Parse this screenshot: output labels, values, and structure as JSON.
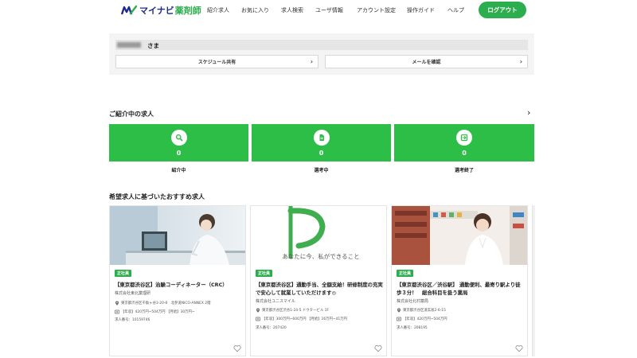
{
  "header": {
    "logo_text": "マイナビ",
    "logo_sub": "薬剤師",
    "nav": [
      "紹介求人",
      "お気に入り",
      "求人検索",
      "ユーザ情報",
      "アカウント設定",
      "操作ガイド",
      "ヘルプ"
    ],
    "logout_label": "ログアウト"
  },
  "user": {
    "suffix": "さま",
    "schedule_share_label": "スケジュール共有",
    "check_mail_label": "メールを確認"
  },
  "introduced": {
    "title": "ご紹介中の求人",
    "cards": [
      {
        "icon": "search-icon",
        "count": "0",
        "label": "紹介中"
      },
      {
        "icon": "document-icon",
        "count": "0",
        "label": "選考中"
      },
      {
        "icon": "exit-icon",
        "count": "0",
        "label": "選考終了"
      }
    ]
  },
  "recommended": {
    "title": "希望求人に基づいたおすすめ求人",
    "jobs": [
      {
        "badge": "正社員",
        "title": "【東京都渋谷区】治験コーディネーター（CRC）",
        "company": "株式会社東北業理研",
        "address": "東京都渋谷区千駄ヶ谷3-20-6　北参道NICO-ANNEX 2階",
        "salary": "【年収】420万円~504万円 【月給】30万円~",
        "number": "求人番号：10159746"
      },
      {
        "badge": "正社員",
        "title": "【東京都渋谷区】通勤手当、全額支給！研修制度の充実で安心して就業していただけます◎",
        "company": "株式会社ユニスマイル",
        "address": "東京都渋谷区渋谷1-24-5 ドウタービル 1F",
        "salary": "【年収】300万円~600万円 【月給】26万円~41万円",
        "number": "求人番号：207420"
      },
      {
        "badge": "正社員",
        "title": "【東京都渋谷区／渋谷駅】 通勤便利、最寄り駅より徒歩３分！　総合科目を扱う薬局",
        "company": "株式会社北村薬局",
        "address": "東京都渋谷区道玄坂2-6-15",
        "salary": "【年収】420万円~504万円",
        "number": "求人番号：208195"
      }
    ],
    "slogan": "あなたに今、私ができること"
  },
  "colors": {
    "brand_green": "#2dae4e",
    "status_green": "#2dbe47",
    "logo_navy": "#1e2a8c"
  }
}
